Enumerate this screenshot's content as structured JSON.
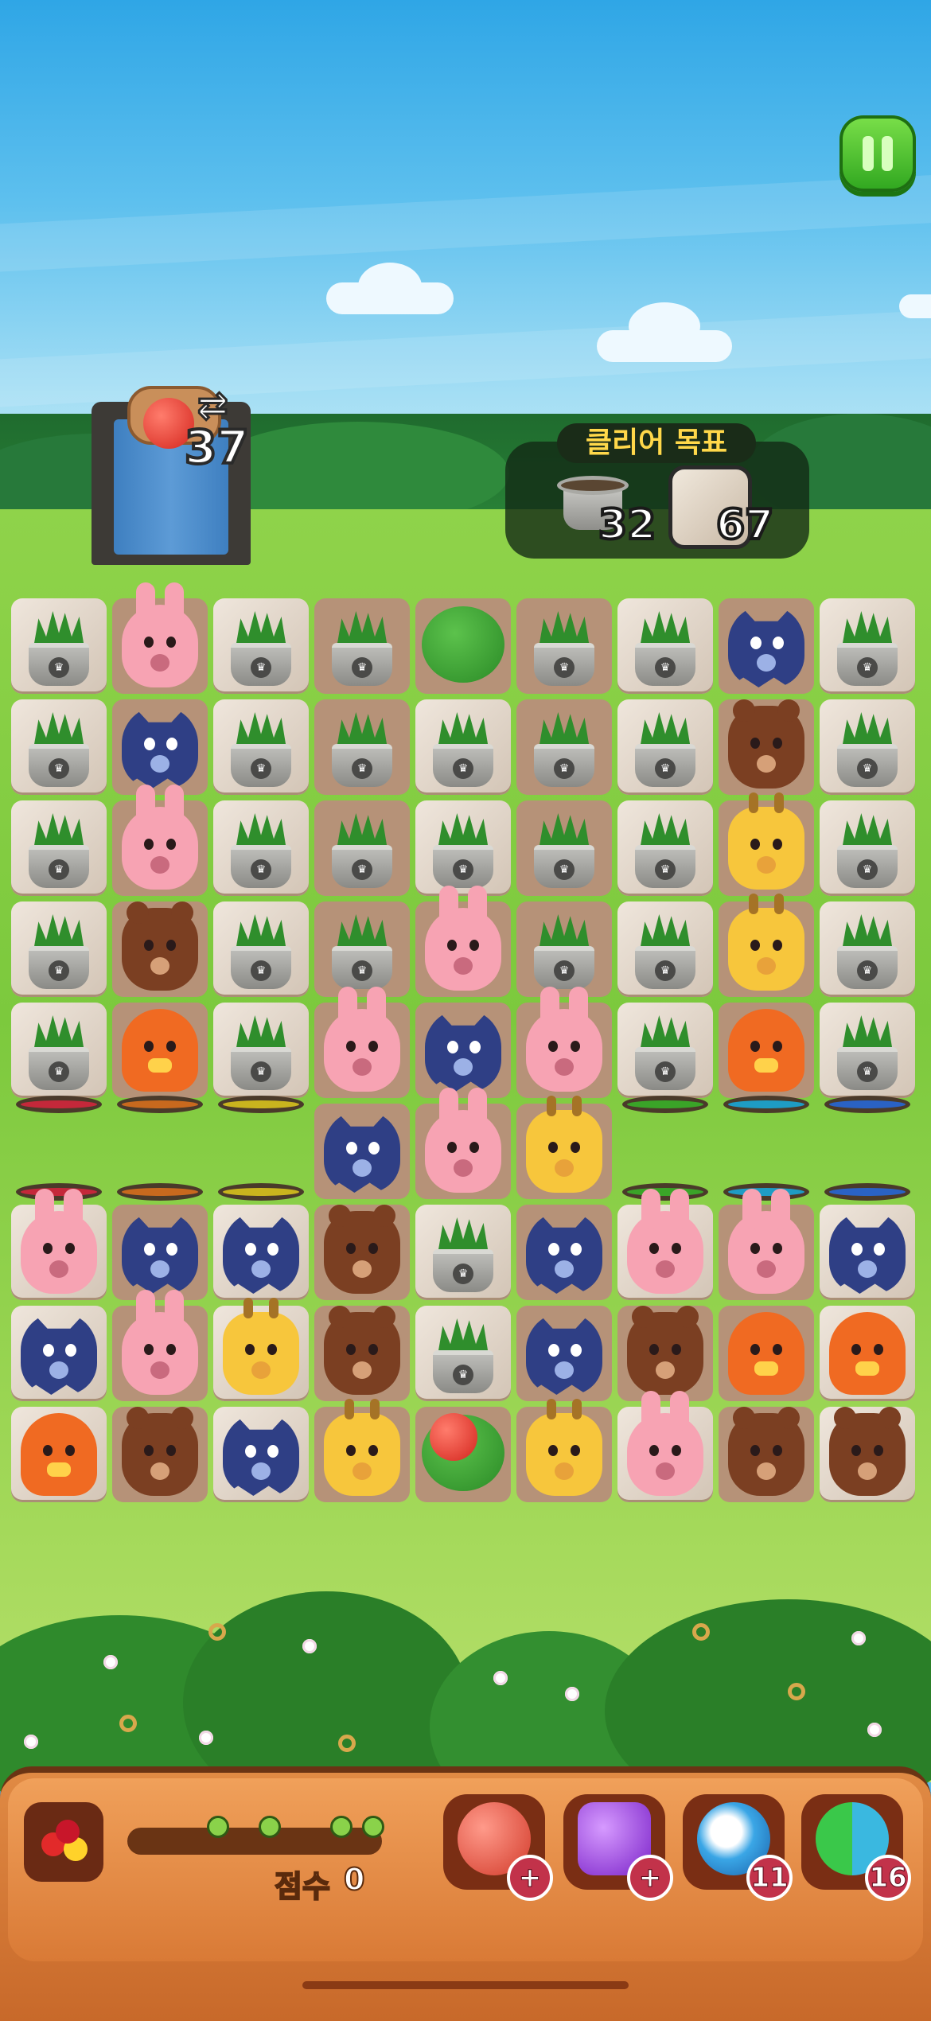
{
  "hud": {
    "moves_remaining": "37",
    "moves_swap_glyph": "⇄",
    "pause_icon": "pause-icon"
  },
  "goal": {
    "title": "클리어 목표",
    "pot_count": "32",
    "stone_count": "67"
  },
  "board": {
    "columns": 9,
    "rows": 9,
    "cells": [
      [
        "pot",
        "rabbit",
        "pot",
        "pot",
        "bush",
        "pot",
        "pot",
        "wolf",
        "pot"
      ],
      [
        "pot",
        "wolf",
        "pot",
        "pot",
        "pot",
        "pot",
        "pot",
        "bear",
        "pot"
      ],
      [
        "pot",
        "rabbit",
        "pot",
        "pot",
        "pot",
        "pot",
        "pot",
        "giraffe",
        "pot"
      ],
      [
        "pot",
        "bear",
        "pot",
        "pot",
        "rabbit",
        "pot",
        "pot",
        "giraffe",
        "pot"
      ],
      [
        "pot",
        "chicken",
        "pot",
        "rabbit",
        "wolf",
        "rabbit",
        "pot",
        "chicken",
        "pot"
      ],
      [
        "portal",
        "portal",
        "portal",
        "wolf",
        "rabbit",
        "giraffe",
        "portal",
        "portal",
        "portal"
      ],
      [
        "rabbit",
        "wolf",
        "wolf",
        "bear",
        "pot",
        "wolf",
        "rabbit",
        "rabbit",
        "wolf"
      ],
      [
        "wolf",
        "rabbit",
        "giraffe",
        "bear",
        "pot",
        "wolf",
        "bear",
        "chicken",
        "chicken"
      ],
      [
        "chicken",
        "bear",
        "wolf",
        "giraffe",
        "apple-bush",
        "giraffe",
        "rabbit",
        "bear",
        "bear"
      ]
    ],
    "stone_cells": [
      [
        0,
        0
      ],
      [
        0,
        2
      ],
      [
        0,
        6
      ],
      [
        0,
        8
      ],
      [
        1,
        0
      ],
      [
        1,
        2
      ],
      [
        1,
        4
      ],
      [
        1,
        6
      ],
      [
        1,
        8
      ],
      [
        2,
        0
      ],
      [
        2,
        2
      ],
      [
        2,
        4
      ],
      [
        2,
        6
      ],
      [
        2,
        8
      ],
      [
        3,
        0
      ],
      [
        3,
        2
      ],
      [
        3,
        6
      ],
      [
        3,
        8
      ],
      [
        4,
        0
      ],
      [
        4,
        2
      ],
      [
        4,
        6
      ],
      [
        4,
        8
      ],
      [
        6,
        0
      ],
      [
        6,
        2
      ],
      [
        6,
        4
      ],
      [
        6,
        6
      ],
      [
        6,
        8
      ],
      [
        7,
        0
      ],
      [
        7,
        2
      ],
      [
        7,
        4
      ],
      [
        7,
        8
      ],
      [
        8,
        0
      ],
      [
        8,
        2
      ],
      [
        8,
        6
      ],
      [
        8,
        8
      ]
    ],
    "portal_colors": [
      "#c4283a",
      "#c8691e",
      "#c9b41e",
      "",
      "",
      "",
      "#3aa428",
      "#1e9cc4",
      "#2a62c4"
    ]
  },
  "footer": {
    "score_label": "점수",
    "score_value": "0",
    "boosters": [
      {
        "icon": "hammer-icon",
        "badge": "+",
        "color": "#e04a3a"
      },
      {
        "icon": "magic-hammer-icon",
        "badge": "+",
        "color": "#9a3ae0"
      },
      {
        "icon": "bomb-icon",
        "badge": "11",
        "color": "#3aa6e6"
      },
      {
        "icon": "shuffle-icon",
        "badge": "16",
        "color": "#3ab8e0"
      }
    ]
  }
}
